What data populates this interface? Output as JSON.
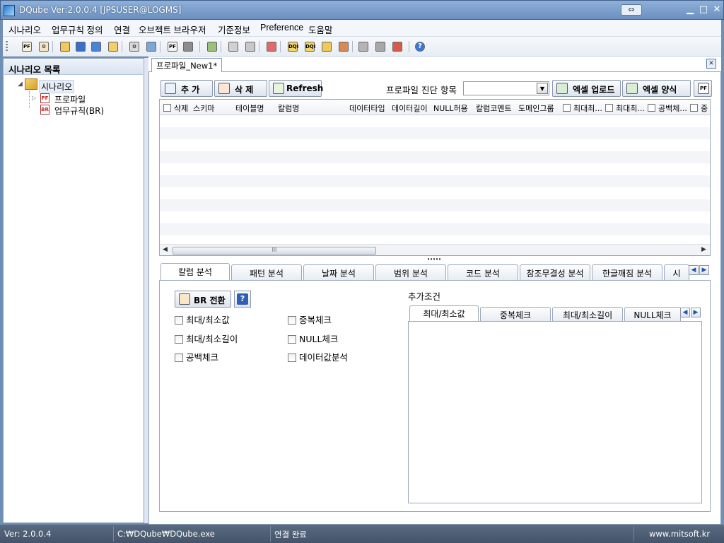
{
  "window": {
    "title": "DQube Ver:2.0.0.4 [JPSUSER@LOGMS]",
    "restore_glyph": "⇔",
    "minimize": "▁",
    "maximize": "□",
    "close": "✕"
  },
  "menu": [
    "시나리오",
    "업무규칙 정의",
    "연결",
    "오브젝트 브라우저",
    "기준정보",
    "Preference",
    "도움말"
  ],
  "toolbar_icons": [
    {
      "name": "profile-pf-icon",
      "glyph": "PF",
      "color": "#f7f0d8"
    },
    {
      "name": "profile-setting-icon",
      "glyph": "⚙",
      "color": "#f3e6c8"
    },
    {
      "name": "open-folder-icon",
      "glyph": "",
      "color": "#f1c95a"
    },
    {
      "name": "save-icon",
      "glyph": "",
      "color": "#3a6fc6"
    },
    {
      "name": "copy-icon",
      "glyph": "",
      "color": "#4a84d8"
    },
    {
      "name": "folder-icon",
      "glyph": "",
      "color": "#f2cf6c"
    },
    {
      "name": "gear-icon",
      "glyph": "⚙",
      "color": "#d9d9d9"
    },
    {
      "name": "monitor-icon",
      "glyph": "",
      "color": "#7aa7d8"
    },
    {
      "name": "pf-report-icon",
      "glyph": "PF",
      "color": "#f3f3f3"
    },
    {
      "name": "grid-icon",
      "glyph": "",
      "color": "#8c8c8c"
    },
    {
      "name": "tree-icon",
      "glyph": "",
      "color": "#9bc07a"
    },
    {
      "name": "link-disabled-icon",
      "glyph": "",
      "color": "#d0d0d0"
    },
    {
      "name": "link-icon",
      "glyph": "",
      "color": "#c8c8c8"
    },
    {
      "name": "user-lock-icon",
      "glyph": "",
      "color": "#e06a6a"
    },
    {
      "name": "dqi-icon",
      "glyph": "DQI",
      "color": "#f5d56a"
    },
    {
      "name": "dqi-folder-icon",
      "glyph": "DQI",
      "color": "#f5d56a"
    },
    {
      "name": "window-icon",
      "glyph": "",
      "color": "#f1c95a"
    },
    {
      "name": "table-icon",
      "glyph": "",
      "color": "#d88a55"
    },
    {
      "name": "tools-icon",
      "glyph": "",
      "color": "#b4b4b4"
    },
    {
      "name": "hammer-icon",
      "glyph": "",
      "color": "#a8a8a8"
    },
    {
      "name": "database-icon",
      "glyph": "",
      "color": "#d85a4a"
    },
    {
      "name": "help-icon",
      "glyph": "?",
      "color": "#3a78d8"
    }
  ],
  "left_panel": {
    "header": "시나리오 목록",
    "tree": {
      "root": "시나리오",
      "children": [
        {
          "label": "프로파일",
          "badge": "PF"
        },
        {
          "label": "업무규칙(BR)",
          "badge": "BR"
        }
      ]
    }
  },
  "document_tab": {
    "label": "프로파일_New1*",
    "close": "✕"
  },
  "actions": {
    "add": "추 가",
    "delete": "삭 제",
    "refresh": "Refresh",
    "diagnosis_label": "프로파일 진단 항목",
    "excel_upload": "엑셀 업로드",
    "excel_template": "엑셀 양식"
  },
  "grid": {
    "columns": [
      "삭제",
      "스키마",
      "테이블명",
      "칼럼명",
      "데이터타입",
      "데이터길이",
      "NULL허용",
      "칼럼코멘트",
      "도메인그룹",
      "최대최...",
      "최대최...",
      "공백체...",
      "중"
    ],
    "scroll_thumb": "lll"
  },
  "analysis_tabs": [
    "칼럼 분석",
    "패턴 분석",
    "날짜 분석",
    "범위 분석",
    "코드 분석",
    "참조무결성 분석",
    "한글깨짐 분석",
    "시"
  ],
  "analysis": {
    "br_button": "BR 전환",
    "help": "?",
    "checks_left": [
      "최대/최소값",
      "최대/최소길이",
      "공백체크"
    ],
    "checks_right": [
      "중복체크",
      "NULL체크",
      "데이터값분석"
    ],
    "extra_label": "추가조건",
    "sub_tabs": [
      "최대/최소값",
      "중복체크",
      "최대/최소길이",
      "NULL체크"
    ]
  },
  "status": {
    "version": "Ver: 2.0.0.4",
    "path": "C:₩DQube₩DQube.exe",
    "connection": "연결 완료",
    "site": "www.mitsoft.kr"
  }
}
